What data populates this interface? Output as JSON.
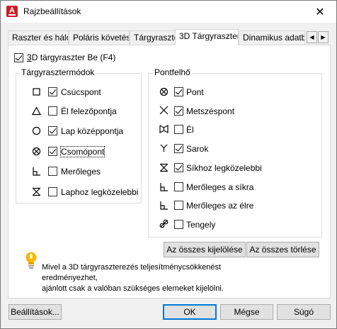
{
  "window": {
    "title": "Rajzbeállítások"
  },
  "tabs": [
    {
      "label": "Raszter és háló",
      "active": false
    },
    {
      "label": "Poláris követés",
      "active": false
    },
    {
      "label": "Tárgyraszter",
      "active": false
    },
    {
      "label": "3D Tárgyraszter",
      "active": true
    },
    {
      "label": "Dinamikus adatbevitel",
      "active": false
    }
  ],
  "osnap3d_on": {
    "label_pre": "",
    "label_ul": "3",
    "label_post": "D tárgyraszter Be (F4)",
    "checked": true
  },
  "modes_group": {
    "title": "Tárgyrasztermódok",
    "items": [
      {
        "icon": "square-icon",
        "label": "Csúcspont",
        "ul": "C",
        "checked": true
      },
      {
        "icon": "triangle-icon",
        "label": "Él felezőpontja",
        "ul": "É",
        "checked": false
      },
      {
        "icon": "circle-icon",
        "label": "Lap középpontja",
        "ul": "",
        "checked": true
      },
      {
        "icon": "circle-x-icon",
        "label": "Csomópont",
        "ul": "",
        "checked": true
      },
      {
        "icon": "perpendicular-icon",
        "label": "Merőleges",
        "ul": "",
        "checked": false
      },
      {
        "icon": "hourglass-icon",
        "label": "Laphoz legközelebbi",
        "ul": "",
        "checked": false
      }
    ]
  },
  "cloud_group": {
    "title": "Pontfelhő",
    "items": [
      {
        "icon": "circle-x-icon",
        "label": "Pont",
        "checked": true
      },
      {
        "icon": "cross-icon",
        "label": "Metszéspont",
        "checked": true
      },
      {
        "icon": "edge-icon",
        "label": "Él",
        "checked": false
      },
      {
        "icon": "corner-icon",
        "label": "Sarok",
        "checked": true
      },
      {
        "icon": "hourglass-icon",
        "label": "Síkhoz legközelebbi",
        "checked": true
      },
      {
        "icon": "perpendicular-icon",
        "label": "Merőleges a síkra",
        "checked": false
      },
      {
        "icon": "perpendicular-icon",
        "label": "Merőleges az élre",
        "checked": false
      },
      {
        "icon": "axis-icon",
        "label": "Tengely",
        "checked": false
      }
    ]
  },
  "select_all": "Az összes kijelölése",
  "clear_all": "Az összes törlése",
  "info": {
    "line1": "Mivel a 3D tárgyraszterezés teljesítménycsökkenést eredményezhet,",
    "line2": "ajánlott csak a valóban szükséges elemeket kijelölni."
  },
  "footer": {
    "settings": "Beállítások...",
    "ok": "OK",
    "cancel": "Mégse",
    "help": "Súgó"
  },
  "colors": {
    "accent": "#0078d7",
    "warning_bulb": "#f5b800",
    "app_icon": "#c8202a"
  }
}
